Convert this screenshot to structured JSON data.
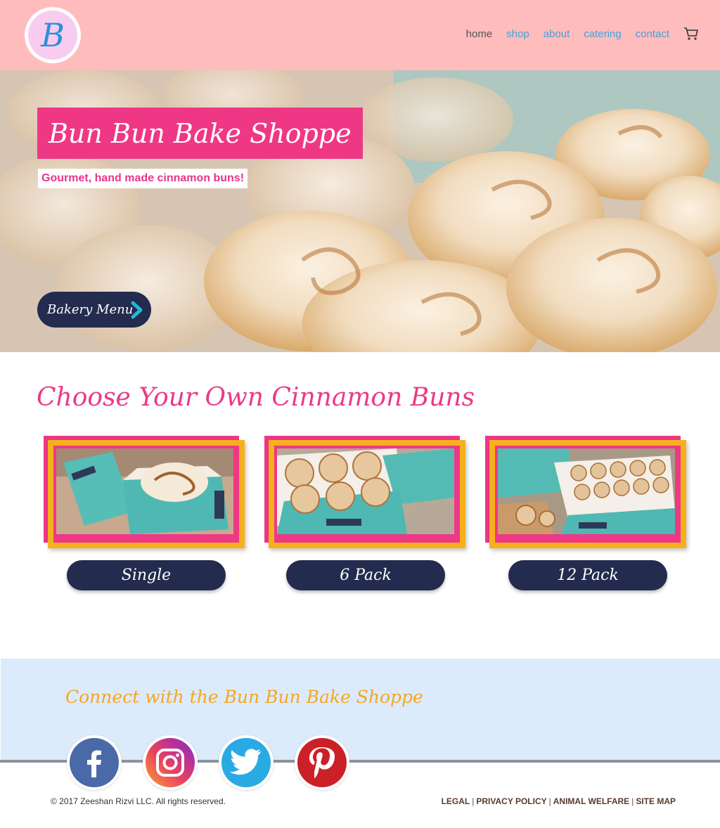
{
  "header": {
    "logo_letter": "B",
    "nav": [
      {
        "label": "home",
        "active": true
      },
      {
        "label": "shop",
        "active": false
      },
      {
        "label": "about",
        "active": false
      },
      {
        "label": "catering",
        "active": false
      },
      {
        "label": "contact",
        "active": false
      }
    ],
    "cart_icon": "shopping-cart-icon"
  },
  "hero": {
    "title": "Bun Bun Bake Shoppe",
    "subtitle": "Gourmet, hand made cinnamon buns!",
    "menu_button": "Bakery Menu"
  },
  "products": {
    "heading": "Choose Your Own Cinnamon Buns",
    "items": [
      {
        "label": "Single"
      },
      {
        "label": "6 Pack"
      },
      {
        "label": "12 Pack"
      }
    ]
  },
  "footer": {
    "heading": "Connect with the Bun Bun Bake Shoppe",
    "social": [
      {
        "name": "facebook",
        "color": "#3b5998"
      },
      {
        "name": "instagram",
        "color": "#c13584"
      },
      {
        "name": "twitter",
        "color": "#1da1f2"
      },
      {
        "name": "pinterest",
        "color": "#cb2027"
      }
    ],
    "copyright": "© 2017 Zeeshan Rizvi LLC. All rights reserved.",
    "links": [
      "LEGAL",
      "PRIVACY POLICY",
      "ANIMAL WELFARE",
      "SITE MAP"
    ],
    "separator": "|"
  },
  "colors": {
    "header_bg": "#ffbcbc",
    "accent_pink": "#ee3886",
    "navy": "#232b4e",
    "frame_gold": "#f6b01c",
    "footer_bg": "#dcebfb",
    "footer_title": "#f5a623"
  }
}
